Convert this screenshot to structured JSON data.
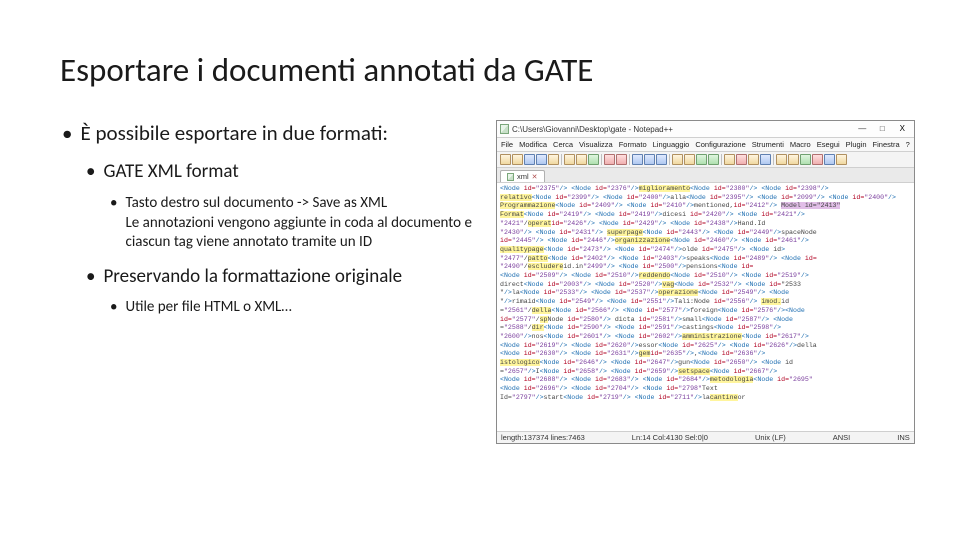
{
  "title": "Esportare i documenti annotati da GATE",
  "bullets": {
    "b1": "È possibile esportare in due formati:",
    "b2a": "GATE XML format",
    "b3a": "Tasto destro sul documento -> Save as XML\nLe annotazioni vengono aggiunte in coda al documento e ciascun tag viene annotato tramite un ID",
    "b2b": "Preservando la formattazione originale",
    "b3b": "Utile per file HTML o XML…"
  },
  "notepadpp": {
    "titlebar": "C:\\Users\\Giovanni\\Desktop\\gate - Notepad++",
    "winbtns": {
      "min": "—",
      "max": "□",
      "close": "X"
    },
    "menus": [
      "File",
      "Modifica",
      "Cerca",
      "Visualizza",
      "Formato",
      "Linguaggio",
      "Configurazione",
      "Strumenti",
      "Macro",
      "Esegui",
      "Plugin",
      "Finestra",
      "?"
    ],
    "tab": {
      "name": "xml",
      "close": "✕"
    },
    "statusbar": {
      "left": "length:137374   lines:7463",
      "mid": "Ln:14   Col:4130   Sel:0|0",
      "enc": "Unix (LF)",
      "ansi": "ANSI",
      "ins": "INS"
    },
    "code": [
      {
        "pre": "<Node id=\"2375\"/> <Node id=\"2376\"/>",
        "hlY": "miglioramento",
        "post": "<Node id=\"2380\"/> <Node id=\"2398\"/>"
      },
      {
        "pre": "",
        "hlY": "relativo",
        "post": "<Node id=\"2399\"/> <Node id=\"2400\"/>alla<Node id=\"2395\"/> <Node id=\"2099\"/> <Node id=\"2400\"/>"
      },
      {
        "pre": "",
        "hlY": "Programmazione",
        "post": "<Node id=\"2409\"/> <Node id=\"2410\"/>mentioned,id=\"2412\"/> ",
        "hlP": "Model id=\"2413\""
      },
      {
        "pre": "",
        "hlY": "Format",
        "post": "<Node id=\"2419\"/> <Node id=\"2419\"/>dicesi id=\"2420\"/> <Node id=\"2421\"/>"
      },
      {
        "pre": "\"2421\"/",
        "hlY": "operat",
        "post": "id=\"2426\"/> <Node id=\"2429\"/> <Node id=\"2438\"/>Hand.Id"
      },
      {
        "pre": "\"2430\"/> <Node id=\"2431\"/> ",
        "hlY": "superpage",
        "post": "<Node id=\"2443\"/> <Node id=\"2449\"/>spaceNode"
      },
      {
        "pre": "id=\"2445\"/> <Node id=\"2446\"/>",
        "hlY": "organizzazione",
        "post": "<Node id=\"2460\"/> <Node id=\"2461\"/>"
      },
      {
        "pre": "",
        "hlY": "qualitypage",
        "post": "<Node id=\"2473\"/> <Node id=\"2474\"/>olde id=\"2475\"/> <Node id>"
      },
      {
        "pre": "\"2477\"/",
        "hlY": "patto",
        "post": "<Node id=\"2402\"/> <Node id=\"2403\"/>speaks<Node id=\"2489\"/> <Node id="
      },
      {
        "pre": "\"2490\"/",
        "hlY": "escludere",
        "post": "id.in\"2499\"/> <Node id=\"2500\"/>pensions<Node id="
      },
      {
        "pre": "<Node id=\"2509\"/> <Node id=\"2510\"/>",
        "hlY": "reddendo",
        "post": "<Node id=\"2510\"/> <Node id=\"2519\"/>"
      },
      {
        "pre": "direct<Node id=\"2003\"/> <Node id=\"2520\"/>",
        "hlY": "vag",
        "post": "<Node id=\"2532\"/> <Node id=\"2533"
      },
      {
        "pre": "\"/>la<Node id=\"2533\"/> <Node id=\"2537\"/>",
        "hlY": "operazione",
        "post": "<Node id=\"2549\"/> <Node"
      },
      {
        "pre": "\"/>rimaid<Node id=\"2549\"/> <Node id=\"2551\"/>Tali:Node id=\"2556\"/> ",
        "hlY": "imod.",
        "post": "id"
      },
      {
        "pre": "=\"2561\"/",
        "hlY": "della",
        "post": "<Node id=\"2566\"/> <Node id=\"2577\"/>foreign<Node id=\"2576\"/><Node"
      },
      {
        "pre": "id=\"2577\"/",
        "hlY": "sp",
        "post": "Node id=\"2580\"/> dicta id=\"2581\"/>small<Node id=\"2587\"/> <Node"
      },
      {
        "pre": "=\"2588\"/",
        "hlY": "dir",
        "post": "<Node id=\"2590\"/> <Node id=\"2591\"/>castings<Node id=\"2598\"/>"
      },
      {
        "pre": "\"2600\"/>nos<Node id=\"2601\"/> <Node id=\"2602\"/>",
        "hlY": "amministrazione",
        "post": "<Node id=\"2617\"/>"
      },
      {
        "pre": "<Node id=\"2619\"/> <Node id=\"2620\"/>essor<Node id=\"2625\"/> <Node id=\"2626\"/>della",
        "hlY": "",
        "post": ""
      },
      {
        "pre": "<Node id=\"2630\"/> <Node id=\"2631\"/>",
        "hlY": "gem",
        "post": "id=\"2635\"/>,<Node id=\"2636\"/>"
      },
      {
        "pre": "",
        "hlY": "istologico",
        "post": "<Node id=\"2646\"/> <Node id=\"2647\"/>gun<Node id=\"2650\"/> <Node id"
      },
      {
        "pre": "=\"2657\"/>I<Node id=\"2658\"/> <Node id=\"2659\"/>",
        "hlY": "setspace",
        "post": "<Node id=\"2667\"/>"
      },
      {
        "pre": "<Node id=\"2688\"/> <Node id=\"2683\"/> <Node id=\"2684\"/>",
        "hlY": "metodologia",
        "post": "<Node id=\"2695\""
      },
      {
        "pre": "<Node id=\"2696\"/> <Node id=\"2704\"/> <Node id=\"2798\"",
        "hlY": "",
        "post": "Text"
      },
      {
        "pre": "Id=\"2797\"/>start<Node id=\"2719\"/> <Node id=\"2711\"/>la",
        "hlY": "cantine",
        "post": "or"
      }
    ]
  }
}
